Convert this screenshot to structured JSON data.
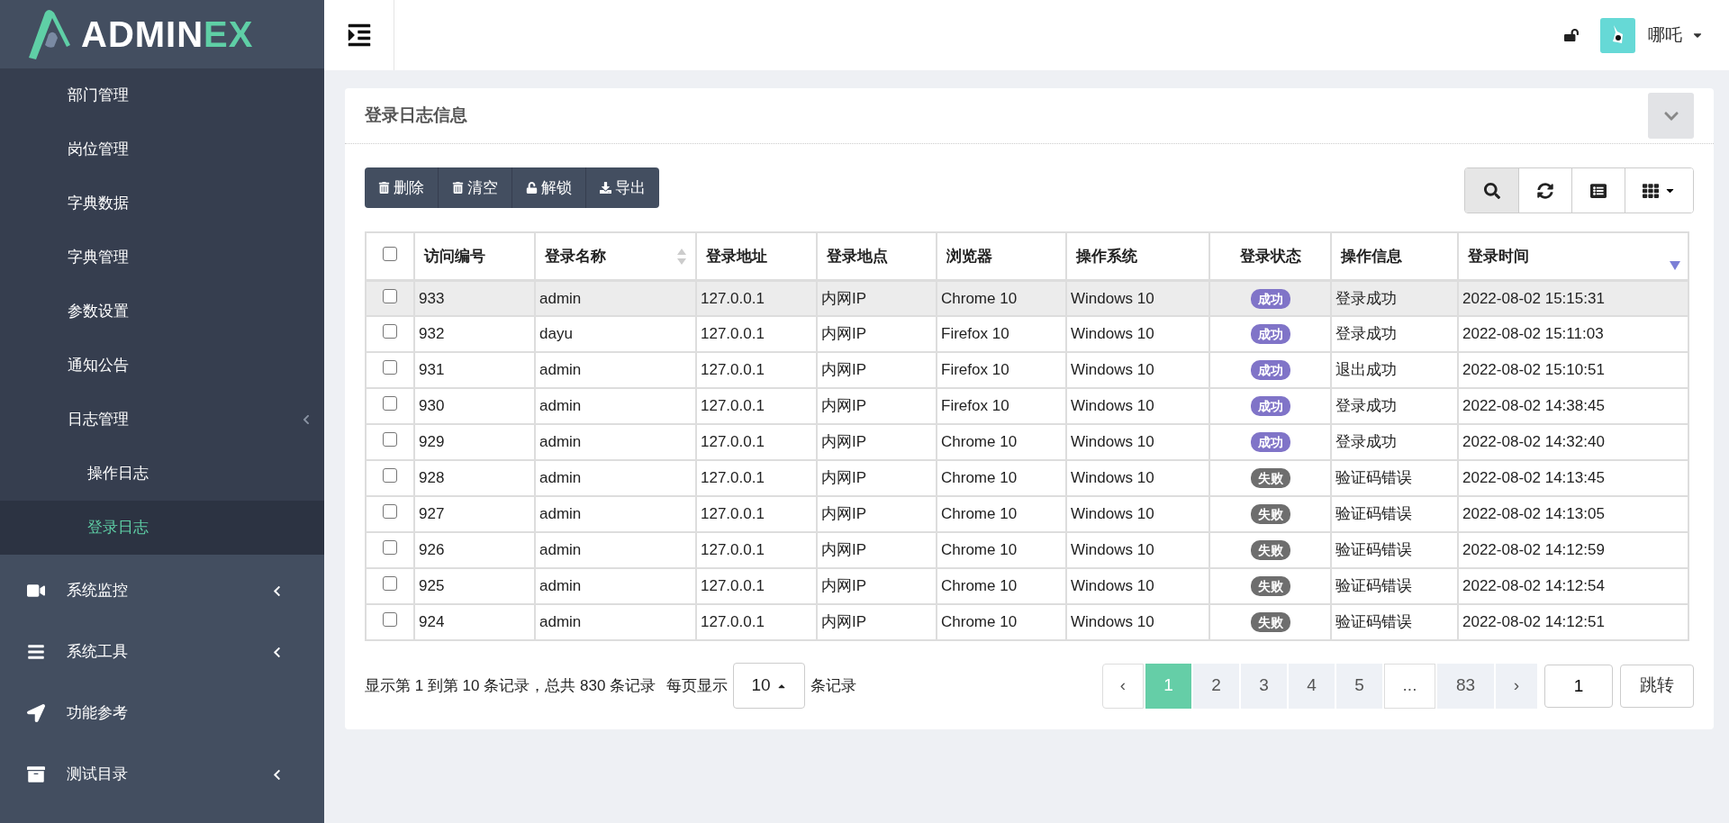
{
  "logo": {
    "text_main": "ADMIN",
    "text_accent": "EX"
  },
  "sidebar": {
    "submenu_items": [
      {
        "label": "部门管理",
        "selected": false
      },
      {
        "label": "岗位管理",
        "selected": false
      },
      {
        "label": "字典数据",
        "selected": false
      },
      {
        "label": "字典管理",
        "selected": false
      },
      {
        "label": "参数设置",
        "selected": false
      },
      {
        "label": "通知公告",
        "selected": false
      },
      {
        "label": "日志管理",
        "selected": false,
        "has_submenu": true,
        "children": [
          {
            "label": "操作日志",
            "selected": false
          },
          {
            "label": "登录日志",
            "selected": true
          }
        ]
      }
    ],
    "menu_items": [
      {
        "label": "系统监控",
        "kind": "video",
        "has_submenu": true
      },
      {
        "label": "系统工具",
        "kind": "bars",
        "has_submenu": true
      },
      {
        "label": "功能参考",
        "kind": "location",
        "has_submenu": false
      },
      {
        "label": "测试目录",
        "kind": "archive",
        "has_submenu": true
      }
    ]
  },
  "header": {
    "user_name": "哪吒"
  },
  "card": {
    "title": "登录日志信息"
  },
  "toolbar": {
    "buttons": [
      {
        "label": "删除",
        "kind": "trash"
      },
      {
        "label": "清空",
        "kind": "trash"
      },
      {
        "label": "解锁",
        "kind": "unlock"
      },
      {
        "label": "导出",
        "kind": "download"
      }
    ],
    "tools": [
      {
        "kind": "search",
        "selected": true
      },
      {
        "kind": "refresh",
        "selected": false
      },
      {
        "kind": "list",
        "selected": false
      },
      {
        "kind": "columns",
        "selected": false
      }
    ]
  },
  "table": {
    "select_all_checked": false,
    "columns": [
      {
        "label": "访问编号"
      },
      {
        "label": "登录名称",
        "sortable": true
      },
      {
        "label": "登录地址"
      },
      {
        "label": "登录地点"
      },
      {
        "label": "浏览器"
      },
      {
        "label": "操作系统"
      },
      {
        "label": "登录状态"
      },
      {
        "label": "操作信息"
      },
      {
        "label": "登录时间",
        "sorted_descending": true
      }
    ],
    "rows": [
      {
        "checked": false,
        "highlighted": true,
        "cells": [
          "933",
          "admin",
          "127.0.0.1",
          "内网IP",
          "Chrome 10",
          "Windows 10"
        ],
        "status": {
          "text": "成功",
          "kind": "success"
        },
        "message": "登录成功",
        "time": "2022-08-02 15:15:31"
      },
      {
        "checked": false,
        "highlighted": false,
        "cells": [
          "932",
          "dayu",
          "127.0.0.1",
          "内网IP",
          "Firefox 10",
          "Windows 10"
        ],
        "status": {
          "text": "成功",
          "kind": "success"
        },
        "message": "登录成功",
        "time": "2022-08-02 15:11:03"
      },
      {
        "checked": false,
        "highlighted": false,
        "cells": [
          "931",
          "admin",
          "127.0.0.1",
          "内网IP",
          "Firefox 10",
          "Windows 10"
        ],
        "status": {
          "text": "成功",
          "kind": "success"
        },
        "message": "退出成功",
        "time": "2022-08-02 15:10:51"
      },
      {
        "checked": false,
        "highlighted": false,
        "cells": [
          "930",
          "admin",
          "127.0.0.1",
          "内网IP",
          "Firefox 10",
          "Windows 10"
        ],
        "status": {
          "text": "成功",
          "kind": "success"
        },
        "message": "登录成功",
        "time": "2022-08-02 14:38:45"
      },
      {
        "checked": false,
        "highlighted": false,
        "cells": [
          "929",
          "admin",
          "127.0.0.1",
          "内网IP",
          "Chrome 10",
          "Windows 10"
        ],
        "status": {
          "text": "成功",
          "kind": "success"
        },
        "message": "登录成功",
        "time": "2022-08-02 14:32:40"
      },
      {
        "checked": false,
        "highlighted": false,
        "cells": [
          "928",
          "admin",
          "127.0.0.1",
          "内网IP",
          "Chrome 10",
          "Windows 10"
        ],
        "status": {
          "text": "失败",
          "kind": "fail"
        },
        "message": "验证码错误",
        "time": "2022-08-02 14:13:45"
      },
      {
        "checked": false,
        "highlighted": false,
        "cells": [
          "927",
          "admin",
          "127.0.0.1",
          "内网IP",
          "Chrome 10",
          "Windows 10"
        ],
        "status": {
          "text": "失败",
          "kind": "fail"
        },
        "message": "验证码错误",
        "time": "2022-08-02 14:13:05"
      },
      {
        "checked": false,
        "highlighted": false,
        "cells": [
          "926",
          "admin",
          "127.0.0.1",
          "内网IP",
          "Chrome 10",
          "Windows 10"
        ],
        "status": {
          "text": "失败",
          "kind": "fail"
        },
        "message": "验证码错误",
        "time": "2022-08-02 14:12:59"
      },
      {
        "checked": false,
        "highlighted": false,
        "cells": [
          "925",
          "admin",
          "127.0.0.1",
          "内网IP",
          "Chrome 10",
          "Windows 10"
        ],
        "status": {
          "text": "失败",
          "kind": "fail"
        },
        "message": "验证码错误",
        "time": "2022-08-02 14:12:54"
      },
      {
        "checked": false,
        "highlighted": false,
        "cells": [
          "924",
          "admin",
          "127.0.0.1",
          "内网IP",
          "Chrome 10",
          "Windows 10"
        ],
        "status": {
          "text": "失败",
          "kind": "fail"
        },
        "message": "验证码错误",
        "time": "2022-08-02 14:12:51"
      }
    ]
  },
  "footer": {
    "summary": "显示第 1 到第 10 条记录，总共 830 条记录",
    "per_page_label": "每页显示",
    "page_size": "10",
    "per_page_suffix": "条记录",
    "pages": [
      {
        "label": "‹",
        "kind": "prev",
        "selected": false
      },
      {
        "label": "1",
        "kind": "page",
        "selected": true
      },
      {
        "label": "2",
        "kind": "page",
        "selected": false
      },
      {
        "label": "3",
        "kind": "page",
        "selected": false
      },
      {
        "label": "4",
        "kind": "page",
        "selected": false
      },
      {
        "label": "5",
        "kind": "page",
        "selected": false
      },
      {
        "label": "...",
        "kind": "ellipsis",
        "selected": false
      },
      {
        "label": "83",
        "kind": "page",
        "selected": false
      },
      {
        "label": "›",
        "kind": "next",
        "selected": false
      }
    ],
    "jump_value": "1",
    "jump_button": "跳转"
  }
}
